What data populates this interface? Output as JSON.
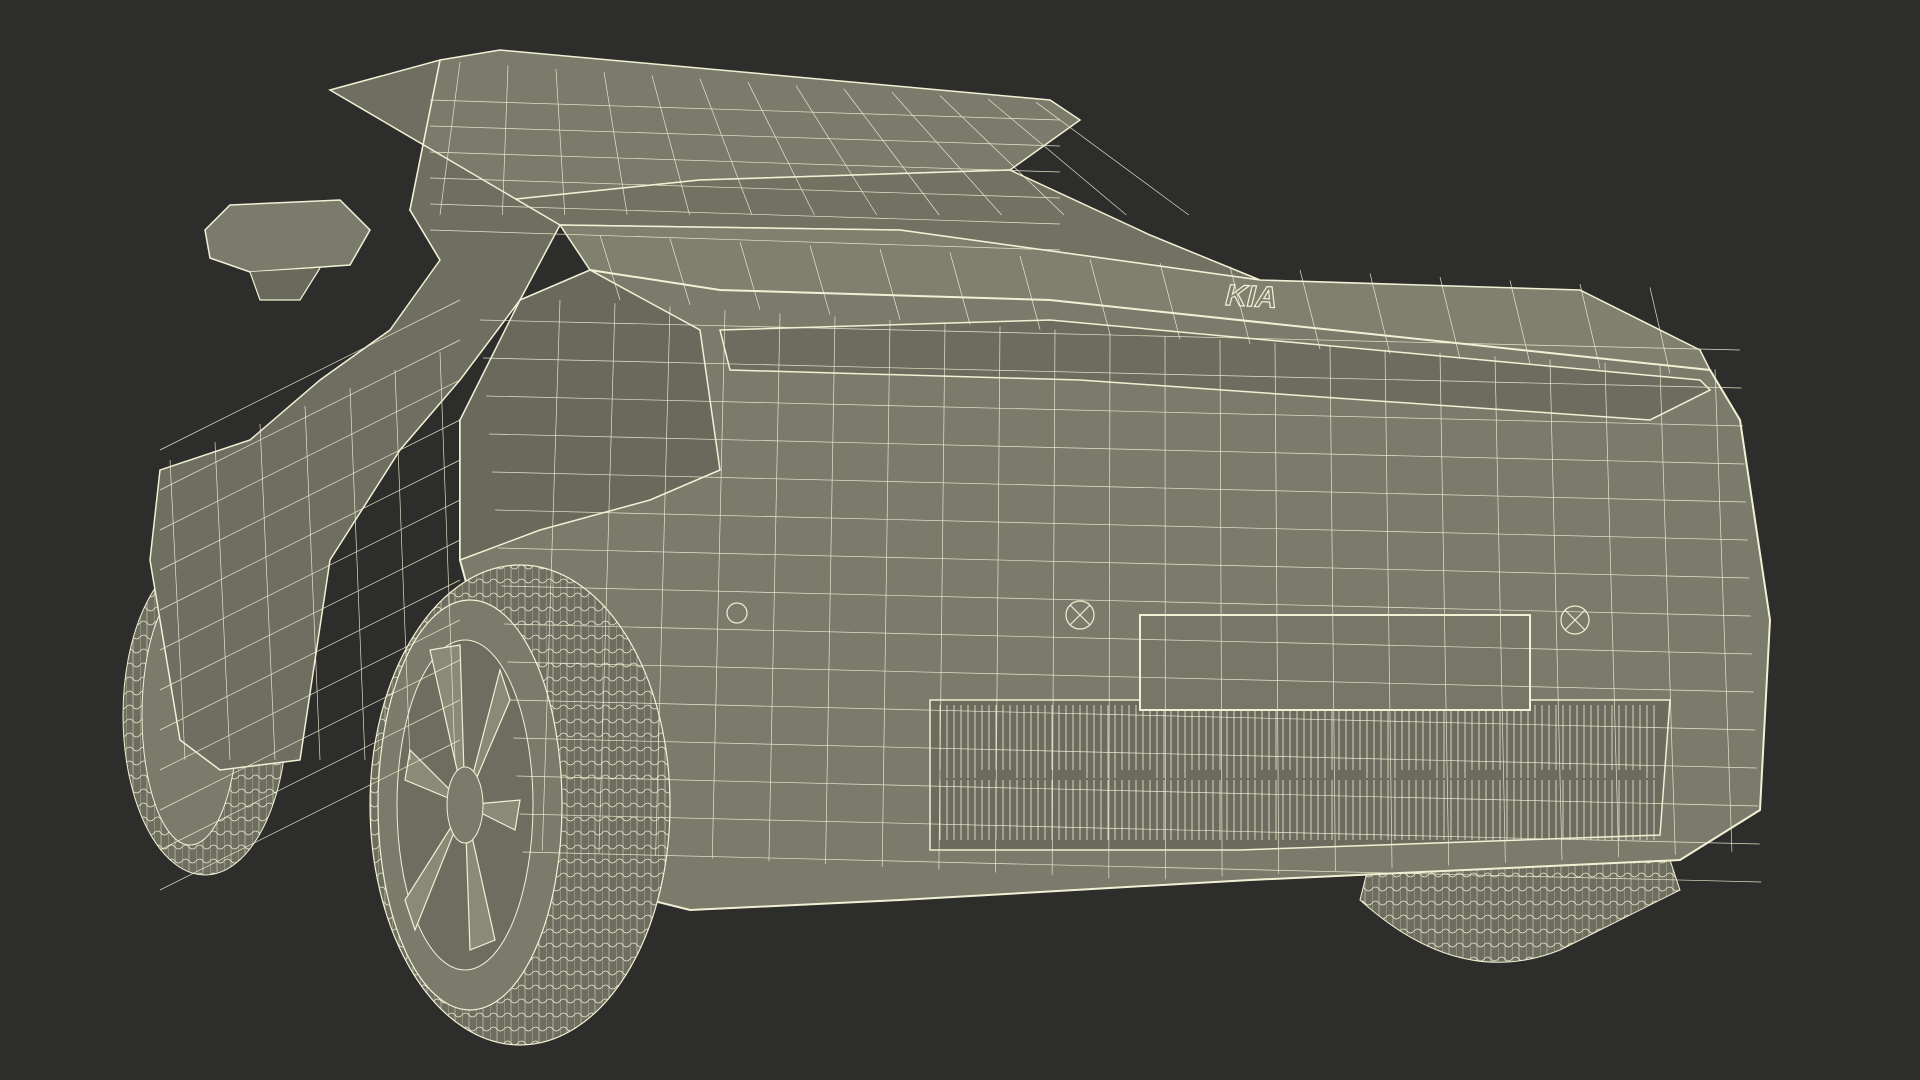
{
  "scene": {
    "subject": "",
    "render_style": "wireframe",
    "background_color": "#2d2d2b",
    "surface_color": "#7b7b6b",
    "surface_dark_color": "#5f5f52",
    "wire_color": "#f2f0d4",
    "tire_color": "#6e6e60",
    "brand_emblem_text": "KIA"
  }
}
